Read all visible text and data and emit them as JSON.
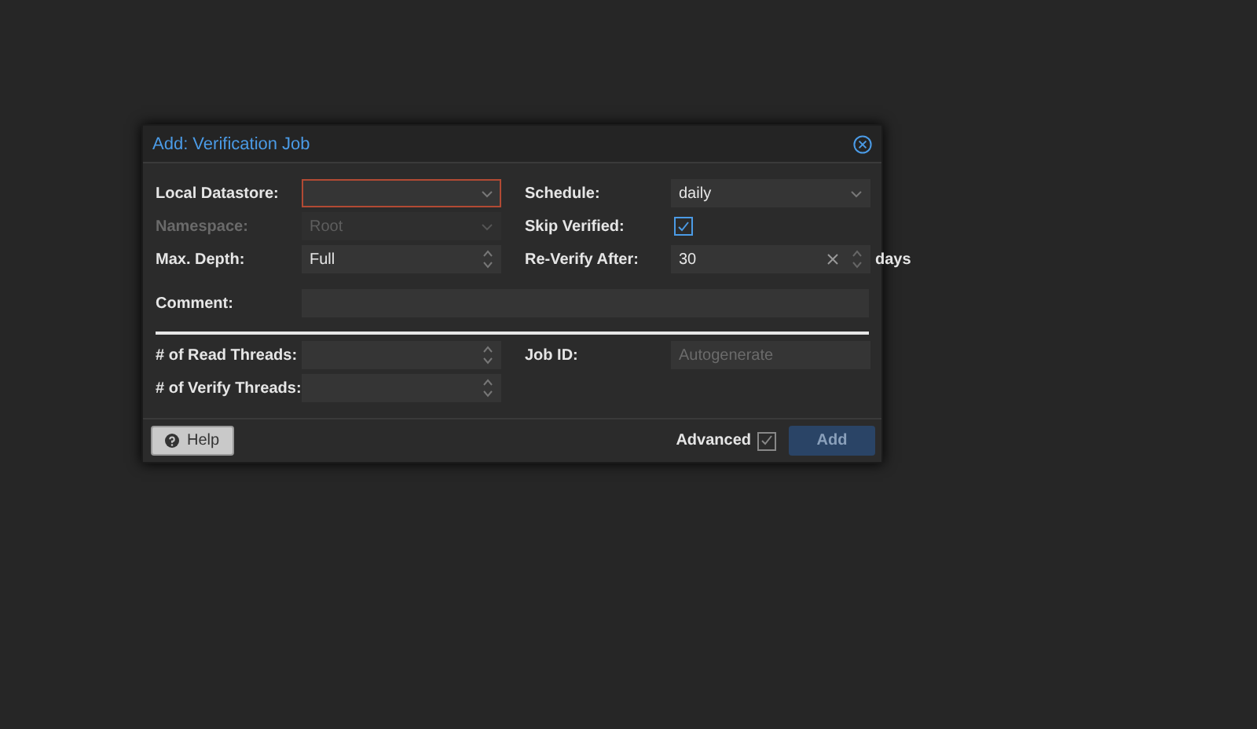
{
  "dialog": {
    "title": "Add: Verification Job"
  },
  "left_fields": [
    {
      "label": "Local Datastore:",
      "kind": "select",
      "invalid": true
    },
    {
      "label": "Namespace:",
      "kind": "select",
      "value": "Root",
      "disabled": true
    },
    {
      "label": "Max. Depth:",
      "kind": "spinner",
      "value": "Full"
    }
  ],
  "right_fields": [
    {
      "label": "Schedule:",
      "kind": "select",
      "value": "daily"
    },
    {
      "label": "Skip Verified:",
      "kind": "checkbox",
      "checked": true
    },
    {
      "label": "Re-Verify After:",
      "kind": "spinner_clear",
      "value": "30",
      "unit": "days"
    }
  ],
  "comment": {
    "label": "Comment:"
  },
  "advanced_left": [
    {
      "label": "# of Read Threads:",
      "kind": "spinner"
    },
    {
      "label": "# of Verify Threads:",
      "kind": "spinner"
    }
  ],
  "advanced_right": [
    {
      "label": "Job ID:",
      "kind": "text",
      "placeholder": "Autogenerate"
    }
  ],
  "footer": {
    "help": "Help",
    "advanced": {
      "label": "Advanced",
      "checked": true
    },
    "submit": {
      "label": "Add",
      "disabled": true
    }
  }
}
